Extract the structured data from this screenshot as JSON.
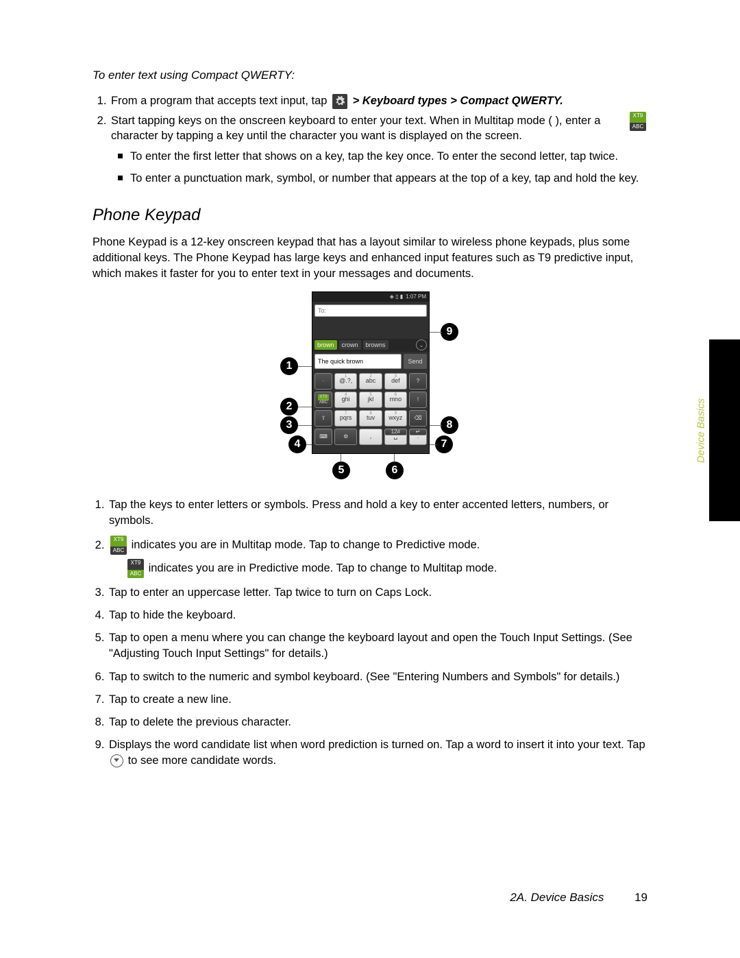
{
  "sideTab": "Device Basics",
  "introHeading": "To enter text using Compact QWERTY:",
  "step1_a": "From a program that accepts text input, tap ",
  "step1_path": " > Keyboard types > Compact QWERTY.",
  "step2_a": "Start tapping keys on the onscreen keyboard to enter your text. When in Multitap mode ( ",
  "step2_b": " ), enter a character by tapping a key until the character you want is displayed on the screen.",
  "sub1": "To enter the first letter that shows on a key, tap the key once. To enter the second letter, tap twice.",
  "sub2": "To enter a punctuation mark, symbol, or number that appears at the top of a key, tap and hold the key.",
  "h2": "Phone Keypad",
  "bodyP": "Phone Keypad is a 12-key onscreen keypad that has a layout similar to wireless phone keypads, plus some additional keys. The Phone Keypad has large keys and enhanced input features such as T9 predictive input, which makes it faster for you to enter text in your messages and documents.",
  "phone": {
    "time": "1:07 PM",
    "toPlaceholder": "To:",
    "cand": [
      "brown",
      "crown",
      "browns"
    ],
    "composeValue": "The quick brown",
    "send": "Send",
    "keys": {
      "r1": [
        "@.?,",
        "abc",
        "def"
      ],
      "r1sup": [
        "1",
        "2",
        "3"
      ],
      "r2": [
        "ghi",
        "jkl",
        "mno"
      ],
      "r2sup": [
        "4",
        "5",
        "6"
      ],
      "r3": [
        "pqrs",
        "tuv",
        "wxyz"
      ],
      "r3sup": [
        "7",
        "8",
        "9"
      ],
      "r4": [
        ",",
        "",
        "."
      ],
      "r4sup": [
        "",
        "0",
        ""
      ],
      "num": "12#"
    }
  },
  "legend": {
    "l1": "Tap the keys to enter letters or symbols. Press and hold a key to enter accented letters, numbers, or symbols.",
    "l2a": " indicates you are in Multitap mode. Tap to change to Predictive mode.",
    "l2b": " indicates you are in Predictive mode. Tap to change to Multitap mode.",
    "l3": "Tap to enter an uppercase letter. Tap twice to turn on Caps Lock.",
    "l4": "Tap to hide the keyboard.",
    "l5": "Tap to open a menu where you can change the keyboard layout and open the Touch Input Settings. (See \"Adjusting Touch Input Settings\" for details.)",
    "l6": "Tap to switch to the numeric and symbol keyboard. (See \"Entering Numbers and Symbols\" for details.)",
    "l7": "Tap to create a new line.",
    "l8": "Tap to delete the previous character.",
    "l9a": "Displays the word candidate list when word prediction is turned on. Tap a word to insert it into your text. Tap ",
    "l9b": " to see more candidate words."
  },
  "xt9": {
    "top": "XT9",
    "bot": "ABC"
  },
  "footer": {
    "section": "2A. Device Basics",
    "page": "19"
  },
  "callouts": {
    "c1": "1",
    "c2": "2",
    "c3": "3",
    "c4": "4",
    "c5": "5",
    "c6": "6",
    "c7": "7",
    "c8": "8",
    "c9": "9"
  }
}
